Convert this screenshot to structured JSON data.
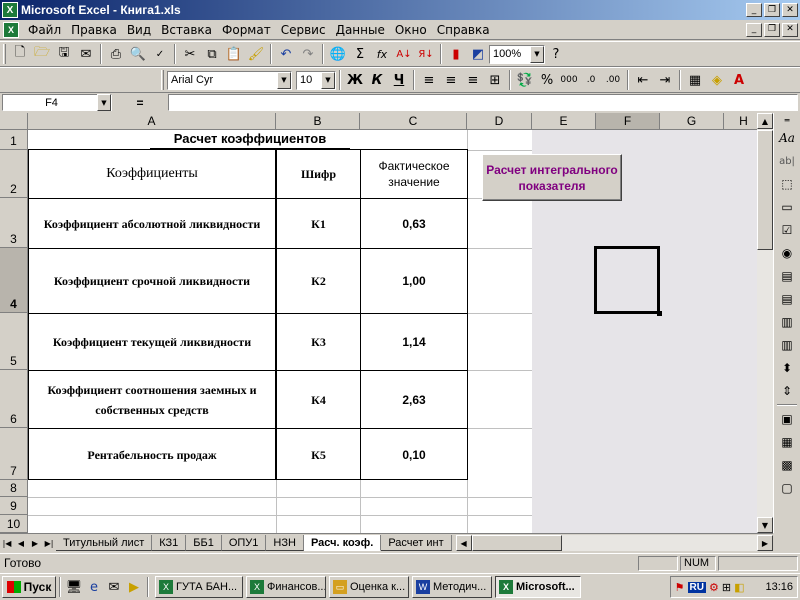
{
  "window": {
    "title": "Microsoft Excel - Книга1.xls",
    "minimize_glyph": "_",
    "restore_glyph": "❐",
    "close_glyph": "✕"
  },
  "menu": {
    "items": [
      "Файл",
      "Правка",
      "Вид",
      "Вставка",
      "Формат",
      "Сервис",
      "Данные",
      "Окно",
      "Справка"
    ]
  },
  "toolbar": {
    "zoom": "100%",
    "font_name": "Arial Cyr",
    "font_size": "10",
    "bold_label": "Ж",
    "italic_label": "К",
    "underline_label": "Ч",
    "percent_label": "%",
    "thousands_label": "000",
    "sum_label": "Σ",
    "fx_label": "fx"
  },
  "formula_bar": {
    "name_box": "F4",
    "equals": "=",
    "value": ""
  },
  "columns": [
    "A",
    "B",
    "C",
    "D",
    "E",
    "F",
    "G",
    "H"
  ],
  "active_column": "F",
  "rows": [
    "1",
    "2",
    "3",
    "4",
    "5",
    "6",
    "7",
    "8",
    "9",
    "10"
  ],
  "sheet": {
    "title": "Расчет коэффициентов",
    "headers": {
      "coef": "Коэффициенты",
      "code": "Шифр",
      "actual": "Фактическое значение"
    },
    "data_rows": [
      {
        "name": "Коэффициент абсолютной ликвидности",
        "code": "К1",
        "value": "0,63"
      },
      {
        "name": "Коэффициент срочной ликвидности",
        "code": "К2",
        "value": "1,00"
      },
      {
        "name": "Коэффициент текущей ликвидности",
        "code": "К3",
        "value": "1,14"
      },
      {
        "name": "Коэффициент соотношения заемных и собственных средств",
        "code": "К4",
        "value": "2,63"
      },
      {
        "name": "Рентабельность продаж",
        "code": "К5",
        "value": "0,10"
      }
    ],
    "button_label": "Расчет интегрального показателя"
  },
  "tabs": {
    "items": [
      "Титульный лист",
      "КЗ1",
      "ББ1",
      "ОПУ1",
      "НЗН",
      "Расч. коэф.",
      "Расчет инт"
    ],
    "active_index": 5
  },
  "status": {
    "ready": "Готово",
    "num": "NUM"
  },
  "taskbar": {
    "start": "Пуск",
    "tasks": [
      {
        "label": "ГУТА БАН...",
        "color": "#1d7a3a"
      },
      {
        "label": "Финансов...",
        "color": "#1d7a3a"
      },
      {
        "label": "Оценка к...",
        "color": "#d4a020"
      },
      {
        "label": "Методич...",
        "color": "#1a3fa0"
      },
      {
        "label": "Microsoft...",
        "color": "#1d7a3a"
      }
    ],
    "active_task_index": 4,
    "lang": "RU",
    "clock": "13:16"
  }
}
